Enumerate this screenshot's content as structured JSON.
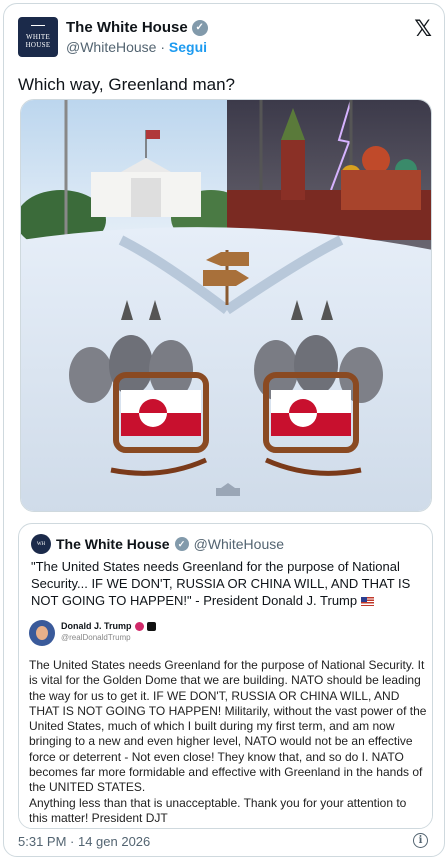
{
  "account": {
    "name": "The White House",
    "handle": "@WhiteHouse",
    "separator": "·",
    "follow_label": "Segui",
    "avatar_text": "WHITE\nHOUSE"
  },
  "tweet": {
    "text": "Which way, Greenland man?",
    "timestamp": "5:31 PM · 14 gen 2026"
  },
  "quote": {
    "name": "The White House",
    "handle": "@WhiteHouse",
    "text": "\"The United States needs Greenland for the purpose of National Security... IF WE DON'T, RUSSIA OR CHINA WILL, AND THAT IS NOT GOING TO HAPPEN!\" - President Donald J. Trump",
    "inner_post": {
      "name": "Donald J. Trump",
      "handle": "@realDonaldTrump",
      "body": "The United States needs Greenland for the purpose of National Security. It is vital for the Golden Dome that we are building. NATO should be leading the way for us to get it. IF WE DON'T, RUSSIA OR CHINA WILL, AND THAT IS NOT GOING TO HAPPEN! Militarily, without the vast power of the United States, much of which I built during my first term, and am now bringing to a new and even higher level, NATO would not be an effective force or deterrent - Not even close! They know that, and so do I. NATO becomes far more formidable and effective with Greenland in the hands of the UNITED STATES.\nAnything less than that is unacceptable. Thank you for your attention to this matter! President DJT"
    }
  },
  "colors": {
    "accent": "#1d9bf0",
    "verified": "#829aab",
    "secondary_text": "#536471",
    "border": "#cfd9de"
  },
  "icons": [
    "verified-badge-icon",
    "x-logo-icon",
    "info-icon",
    "us-flag-icon"
  ]
}
